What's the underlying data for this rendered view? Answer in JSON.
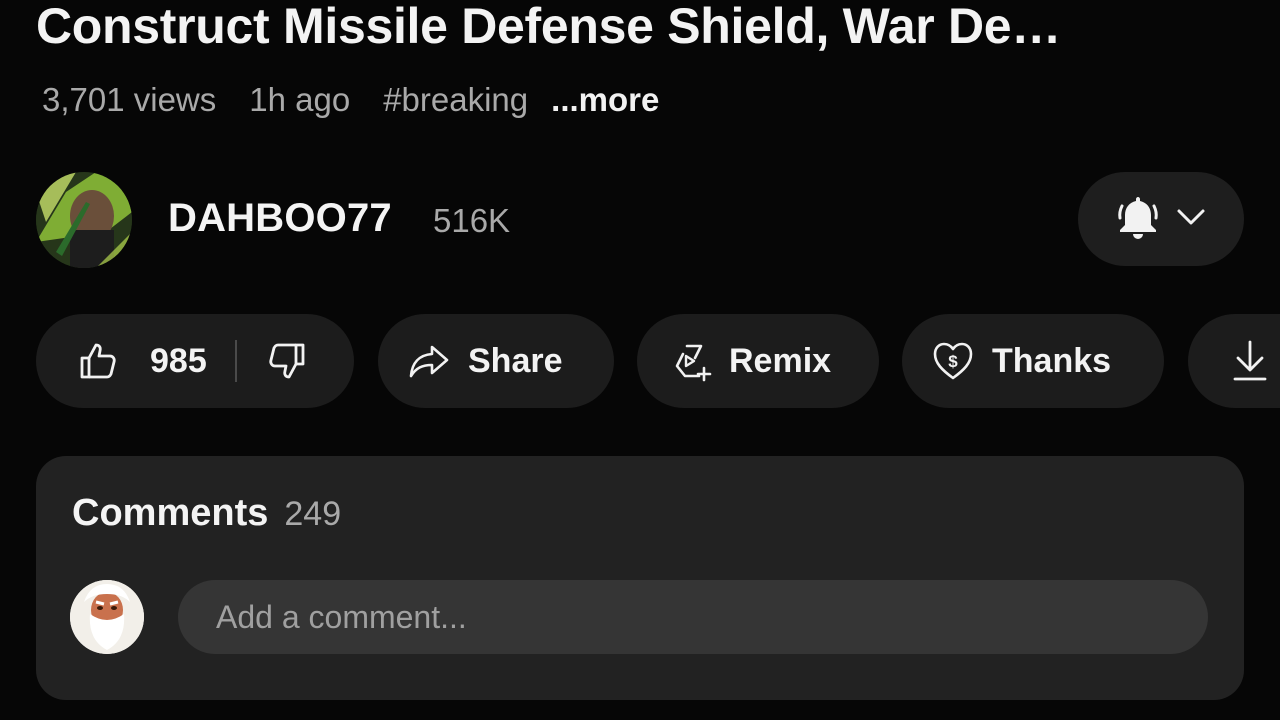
{
  "video": {
    "title": "Construct Missile Defense Shield, War De…",
    "views": "3,701 views",
    "age": "1h ago",
    "hashtag": "#breaking",
    "more_label": "...more"
  },
  "channel": {
    "name": "DAHBOO77",
    "subscribers": "516K",
    "bell_icon": "bell-icon",
    "dropdown_icon": "chevron-down-icon"
  },
  "actions": {
    "like_count": "985",
    "share_label": "Share",
    "remix_label": "Remix",
    "thanks_label": "Thanks"
  },
  "comments": {
    "title": "Comments",
    "count": "249",
    "input_placeholder": "Add a comment..."
  },
  "colors": {
    "background": "#060606",
    "pill": "#1c1c1c",
    "card": "#222222",
    "input": "#353535",
    "secondary_text": "#a9a9a9"
  }
}
